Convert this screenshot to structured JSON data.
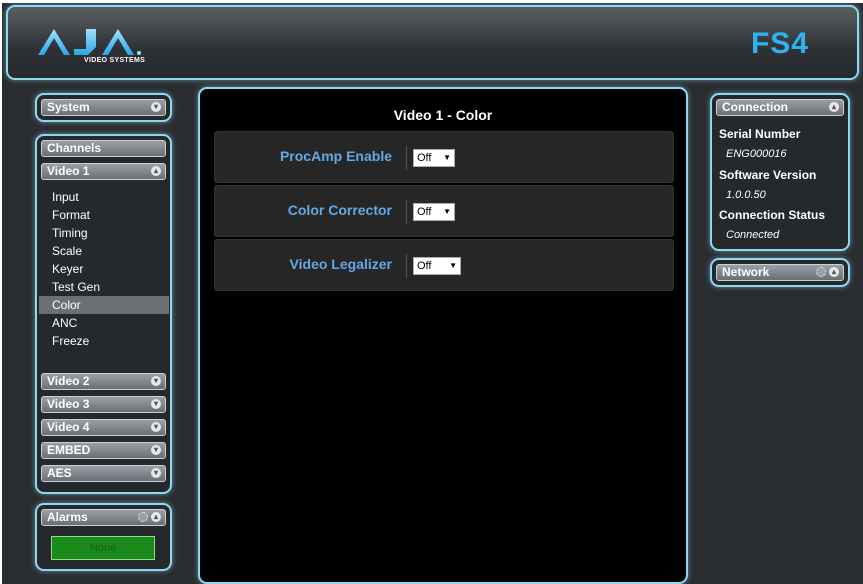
{
  "header": {
    "logo_text": "AJA",
    "logo_subtext": "VIDEO SYSTEMS",
    "product": "FS4"
  },
  "system_panel": {
    "label": "System"
  },
  "channels_panel": {
    "title": "Channels",
    "video1": {
      "label": "Video 1",
      "items": [
        "Input",
        "Format",
        "Timing",
        "Scale",
        "Keyer",
        "Test Gen",
        "Color",
        "ANC",
        "Freeze"
      ],
      "active_item": "Color"
    },
    "others": [
      "Video 2",
      "Video 3",
      "Video 4",
      "EMBED",
      "AES"
    ]
  },
  "alarms_panel": {
    "label": "Alarms",
    "status": "None"
  },
  "main": {
    "title": "Video 1 - Color",
    "rows": [
      {
        "label": "ProcAmp Enable",
        "value": "Off"
      },
      {
        "label": "Color Corrector",
        "value": "Off"
      },
      {
        "label": "Video Legalizer",
        "value": "Off"
      }
    ]
  },
  "connection_panel": {
    "label": "Connection",
    "serial_label": "Serial Number",
    "serial_value": "ENG000016",
    "software_label": "Software Version",
    "software_value": "1.0.0.50",
    "status_label": "Connection Status",
    "status_value": "Connected"
  },
  "network_panel": {
    "label": "Network"
  },
  "colors": {
    "accent": "#2db4f0",
    "label_blue": "#63a9e6",
    "glow": "#8ed8f2",
    "alarm_green": "#1a8a1a"
  },
  "icons": [
    "chevron-down-icon",
    "chevron-up-icon",
    "gear-icon"
  ]
}
